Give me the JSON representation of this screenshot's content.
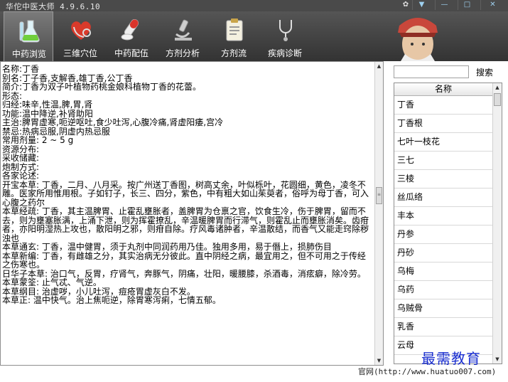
{
  "window": {
    "title": "华佗中医大师 4.9.6.10"
  },
  "toolbar": {
    "tabs": [
      {
        "label": "中药浏览",
        "icon": "flask-icon",
        "active": true
      },
      {
        "label": "三维穴位",
        "icon": "heart-stethoscope-icon",
        "active": false
      },
      {
        "label": "中药配伍",
        "icon": "pills-icon",
        "active": false
      },
      {
        "label": "方剂分析",
        "icon": "microscope-icon",
        "active": false
      },
      {
        "label": "方剂流",
        "icon": "clipboard-icon",
        "active": false
      },
      {
        "label": "疾病诊断",
        "icon": "stethoscope-icon",
        "active": false
      }
    ]
  },
  "info": {
    "lines": [
      "名称:丁香",
      "别名:丁子香,支解香,雄丁香,公丁香",
      "简介:丁香为双子叶植物药桃金娘科植物丁香的花蕾。",
      "形态:",
      "归经:味辛,性温,脾,胃,肾",
      "功能:温中降逆,补肾助阳",
      "主治:脾胃虚寒,呃逆呕吐,食少吐泻,心腹冷痛,肾虚阳痿,宫冷",
      "禁忌:热病忌服,阴虚内热忌服",
      "常用剂量: 2 ~ 5 g",
      "资源分布:",
      "采收储藏:",
      "炮制方式:",
      "各家论述:",
      "开宝本草: 丁香，二月、八月采。按广州送丁香图，树高丈余，叶似栎叶，花圆细，黄色，凌冬不雕。医家所用惟用根。子如钉子，长三、四分，紫色，中有粗大如山茱萸者，俗呼为母丁香，可入心腹之药尔",
      "本草经疏: 丁香，其主温脾胃、止霍乱壅胀者，盖脾胃为仓禀之官，饮食生冷，伤于脾胃，留而不去，则为壅塞胀满，上涌下泄，则为挥霍撩乱，辛温暖脾胃而行滞气，则霍乱止而壅胀消矣。齿疳者，亦阳明湿热上攻也，散阳明之邪，则疳自除。疗风毒诸肿者，辛温散结，而香气又能走窍除秽浊也",
      "本草通玄: 丁香，温中健胃，须于丸剂中同润药用乃佳。独用多用，易于僭上，损肺伤目",
      "本草新编: 丁香，有雌雄之分，其实治病无分彼此。直中阴经之病，最宜用之，但不可用之于传经之伤寒也。",
      "日华子本草: 治口气，反胃，疗肾气，奔豚气，阴痛，壮阳，暖腰膝，杀酒毒，消痃癖，除冷劳。",
      "本草蒙筌: 止气忒、气逆。",
      "本草纲目: 治虚哕，小儿吐泻，痘疮胃虚灰白不发。",
      "本草正: 温中快气。治上焦呃逆，除胃寒泻痢，七情五郁。"
    ]
  },
  "search": {
    "placeholder": "",
    "button_label": "搜索"
  },
  "list": {
    "header": "名称",
    "items": [
      "丁香",
      "丁香根",
      "七叶一枝花",
      "三七",
      "三棱",
      "丝瓜络",
      "丰本",
      "丹参",
      "丹砂",
      "乌梅",
      "乌药",
      "乌贼骨",
      "乳香",
      "云母"
    ]
  },
  "footer": {
    "site": "官网(http://www.huatuo007.com)",
    "watermark": "最需教育"
  },
  "colors": {
    "titlebar": "#4a4a4a",
    "toolbar": "#3f3f3f",
    "watermark": "#1a2fd0"
  }
}
